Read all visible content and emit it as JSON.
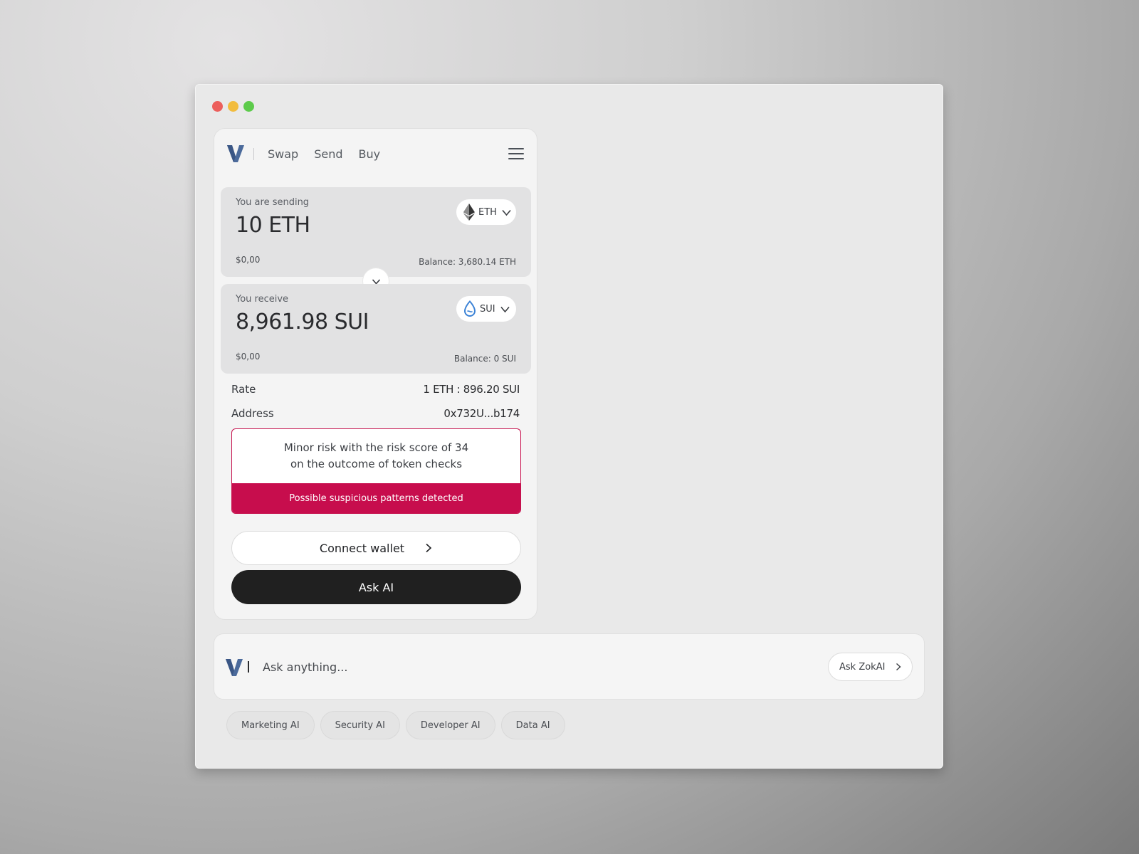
{
  "nav": {
    "links": [
      "Swap",
      "Send",
      "Buy"
    ]
  },
  "send": {
    "label": "You are sending",
    "amount": "10 ETH",
    "usd": "$0,00",
    "balance": "Balance: 3,680.14 ETH",
    "token": "ETH"
  },
  "receive": {
    "label": "You receive",
    "amount": "8,961.98 SUI",
    "usd": "$0,00",
    "balance": "Balance: 0 SUI",
    "token": "SUI"
  },
  "details": {
    "rate_label": "Rate",
    "rate_value": "1 ETH : 896.20 SUI",
    "address_label": "Address",
    "address_value": "0x732U...b174"
  },
  "risk": {
    "line1": "Minor risk with the risk score of 34",
    "line2": "on the outcome of token checks",
    "warning": "Possible suspicious  patterns detected"
  },
  "actions": {
    "connect_label": "Connect wallet",
    "ask_ai_label": "Ask AI"
  },
  "chat": {
    "placeholder": "Ask anything...",
    "button_label": "Ask ZokAI"
  },
  "chips": [
    "Marketing AI",
    "Security AI",
    "Developer AI",
    "Data AI"
  ],
  "colors": {
    "accent_blue": "#4b6a9b",
    "risk_red": "#c70d4d",
    "primary_dark": "#202020",
    "sui_blue": "#3b82d6"
  },
  "icons": {
    "logo": "v-logo-icon",
    "menu": "hamburger-menu-icon",
    "eth": "ethereum-icon",
    "sui": "sui-droplet-icon",
    "switch": "chevron-down-icon",
    "arrow": "chevron-right-icon"
  }
}
